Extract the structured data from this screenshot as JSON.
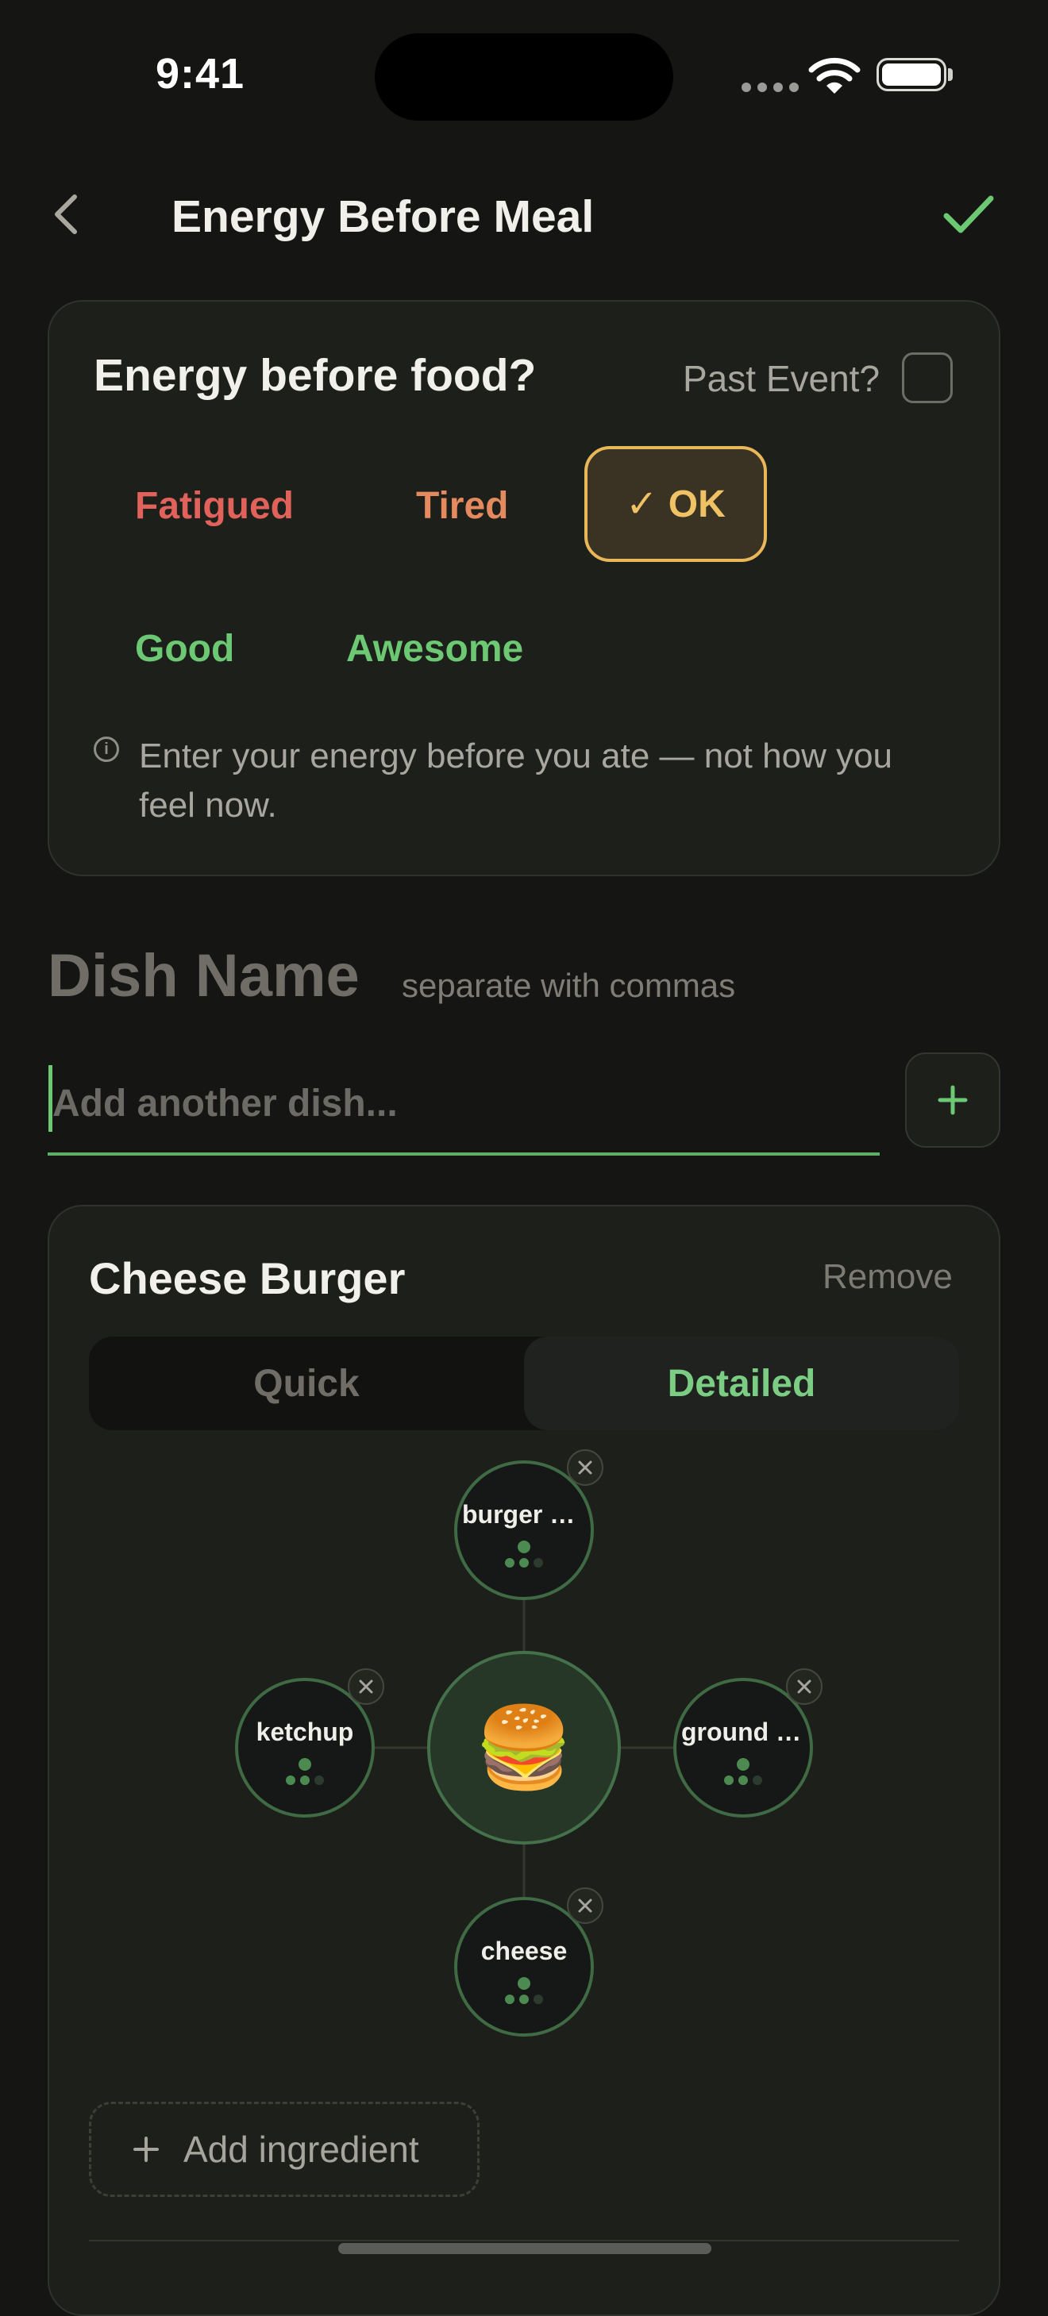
{
  "status_bar": {
    "time": "9:41"
  },
  "nav": {
    "title": "Energy Before Meal",
    "back_icon": "chevron-left-icon",
    "confirm_icon": "checkmark-icon"
  },
  "energy": {
    "question": "Energy before food?",
    "past_event_label": "Past Event?",
    "past_event_checked": false,
    "options": [
      {
        "label": "Fatigued",
        "color": "#e0625a",
        "selected": false
      },
      {
        "label": "Tired",
        "color": "#e58a5e",
        "selected": false
      },
      {
        "label": "OK",
        "color": "#efc265",
        "selected": true
      },
      {
        "label": "Good",
        "color": "#6cc873",
        "selected": false
      },
      {
        "label": "Awesome",
        "color": "#6cc873",
        "selected": false
      }
    ],
    "selected_prefix": "✓",
    "info": "Enter your energy before you ate — not how you feel now."
  },
  "dish_section": {
    "heading": "Dish Name",
    "subheading": "separate with commas",
    "input_placeholder": "Add another dish...",
    "input_value": ""
  },
  "dish_card": {
    "title": "Cheese Burger",
    "remove_label": "Remove",
    "modes": [
      "Quick",
      "Detailed"
    ],
    "selected_mode": "Detailed",
    "center_emoji": "🍔",
    "ingredients": [
      {
        "label": "burger b...",
        "position": "top"
      },
      {
        "label": "ketchup",
        "position": "left"
      },
      {
        "label": "ground b...",
        "position": "right"
      },
      {
        "label": "cheese",
        "position": "bottom"
      }
    ],
    "add_ingredient_label": "Add ingredient"
  },
  "colors": {
    "accent_green": "#6cc873",
    "selected_amber": "#e7b75a",
    "background": "#151614"
  }
}
